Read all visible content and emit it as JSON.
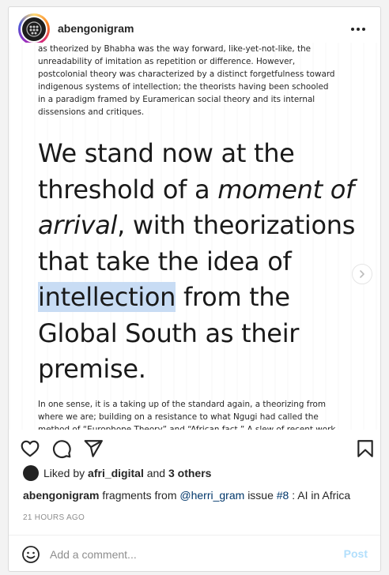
{
  "header": {
    "username": "abengonigram",
    "more_icon": "more-horizontal-icon"
  },
  "post": {
    "text_top": "as theorized by Bhabha was the way forward, like-yet-not-like, the unreadability of imitation as repetition or difference. However, postcolonial theory was characterized by a distinct forgetfulness toward indigenous systems of intellection; the theorists having been schooled in a paradigm framed by Euramerican social theory and its internal dissensions and critiques.",
    "quote_part1": "We stand now at the threshold of a ",
    "quote_em1": "moment of arrival",
    "quote_part2": ", with theorizations that take the idea of ",
    "quote_highlight": "intellection",
    "quote_part3": " from the Global South as their premise.",
    "text_bottom": "In one sense, it is a taking up of the standard again, a theorizing from where we are; building on a resistance to what Ngugi had called the method of “Europhone Theory” and “African fact.” A slew of recent work that"
  },
  "actions": {
    "like_icon": "heart-icon",
    "comment_icon": "comment-icon",
    "share_icon": "send-icon",
    "save_icon": "bookmark-icon"
  },
  "likes": {
    "prefix": "Liked by",
    "user": "afri_digital",
    "joiner": "and",
    "others": "3 others"
  },
  "caption": {
    "username": "abengonigram",
    "text1": "fragments from",
    "mention": "@herri_gram",
    "text2": "issue",
    "hashtag": "#8",
    "text3": ": AI in Africa"
  },
  "timestamp": "21 HOURS AGO",
  "comment": {
    "placeholder": "Add a comment...",
    "post_label": "Post",
    "post_color": "#b2dffc"
  }
}
